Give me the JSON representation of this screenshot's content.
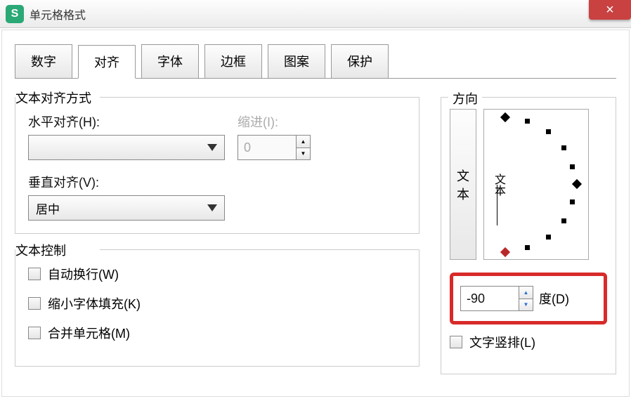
{
  "titlebar": {
    "app_icon_letter": "S",
    "title": "单元格格式",
    "close": "×"
  },
  "tabs": {
    "items": [
      {
        "label": "数字"
      },
      {
        "label": "对齐"
      },
      {
        "label": "字体"
      },
      {
        "label": "边框"
      },
      {
        "label": "图案"
      },
      {
        "label": "保护"
      }
    ],
    "active_index": 1
  },
  "alignment": {
    "fieldset_title": "文本对齐方式",
    "horizontal_label": "水平对齐(H):",
    "horizontal_value": "",
    "indent_label": "缩进(I):",
    "indent_value": "0",
    "vertical_label": "垂直对齐(V):",
    "vertical_value": "居中"
  },
  "text_control": {
    "fieldset_title": "文本控制",
    "wrap_label": "自动换行(W)",
    "shrink_label": "缩小字体填充(K)",
    "merge_label": "合并单元格(M)"
  },
  "orientation": {
    "title": "方向",
    "vtext_chars": [
      "文",
      "本"
    ],
    "dial_label": "文本",
    "degrees_value": "-90",
    "degrees_label": "度(D)",
    "vertical_text_label": "文字竖排(L)"
  }
}
